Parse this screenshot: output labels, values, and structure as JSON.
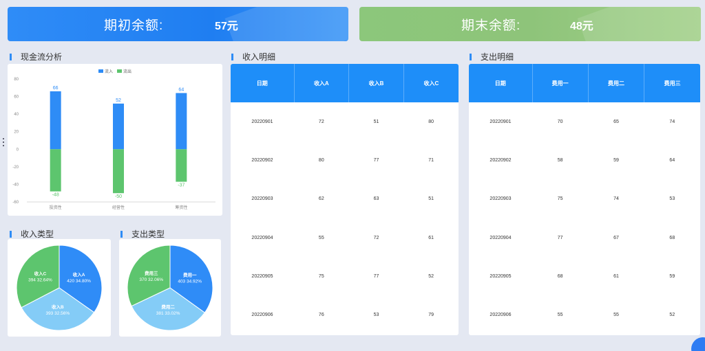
{
  "banners": {
    "opening": {
      "label": "期初余额:",
      "value": "57元"
    },
    "closing": {
      "label": "期末余额:",
      "value": "48元"
    }
  },
  "sections": {
    "cashflow": "现金流分析",
    "income_detail": "收入明细",
    "expense_detail": "支出明细",
    "income_type": "收入类型",
    "expense_type": "支出类型"
  },
  "colors": {
    "inflow": "#2e8cf6",
    "outflow": "#5dc56e",
    "pie_blue": "#2f8cf7",
    "pie_light": "#84ccf7",
    "pie_green": "#5dc56e"
  },
  "income_table": {
    "headers": [
      "日期",
      "收入A",
      "收入B",
      "收入C"
    ],
    "rows": [
      [
        "20220901",
        "72",
        "51",
        "80"
      ],
      [
        "20220902",
        "80",
        "77",
        "71"
      ],
      [
        "20220903",
        "62",
        "63",
        "51"
      ],
      [
        "20220904",
        "55",
        "72",
        "61"
      ],
      [
        "20220905",
        "75",
        "77",
        "52"
      ],
      [
        "20220906",
        "76",
        "53",
        "79"
      ]
    ]
  },
  "expense_table": {
    "headers": [
      "日期",
      "费用一",
      "费用二",
      "费用三"
    ],
    "rows": [
      [
        "20220901",
        "70",
        "65",
        "74"
      ],
      [
        "20220902",
        "58",
        "59",
        "64"
      ],
      [
        "20220903",
        "75",
        "74",
        "53"
      ],
      [
        "20220904",
        "77",
        "67",
        "68"
      ],
      [
        "20220905",
        "68",
        "61",
        "59"
      ],
      [
        "20220906",
        "55",
        "55",
        "52"
      ]
    ]
  },
  "chart_data": [
    {
      "type": "bar",
      "categories": [
        "投资性",
        "经营性",
        "筹资性"
      ],
      "series": [
        {
          "name": "流入",
          "values": [
            66,
            52,
            64
          ]
        },
        {
          "name": "流出",
          "values": [
            -48,
            -50,
            -37
          ]
        }
      ],
      "yticks": [
        80,
        60,
        40,
        20,
        0,
        -20,
        -40,
        -60
      ],
      "ylim": [
        -60,
        80
      ],
      "legend": "top-center",
      "stacked": true
    },
    {
      "type": "pie",
      "slices": [
        {
          "name": "收入A",
          "value": 420,
          "percent": "34.80%"
        },
        {
          "name": "收入B",
          "value": 393,
          "percent": "32.56%"
        },
        {
          "name": "收入C",
          "value": 394,
          "percent": "32.64%"
        }
      ]
    },
    {
      "type": "pie",
      "slices": [
        {
          "name": "费用一",
          "value": 403,
          "percent": "34.92%"
        },
        {
          "name": "费用二",
          "value": 381,
          "percent": "33.02%"
        },
        {
          "name": "费用三",
          "value": 370,
          "percent": "32.06%"
        }
      ]
    }
  ]
}
